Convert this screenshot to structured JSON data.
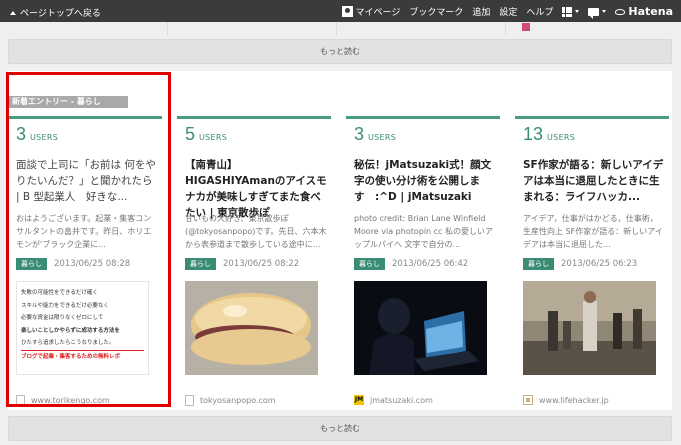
{
  "topbar": {
    "back_label": "ページトップへ戻る",
    "nav": [
      "マイページ",
      "ブックマーク",
      "追加",
      "設定",
      "ヘルプ"
    ],
    "brand": "Hatena"
  },
  "more_label": "もっと読む",
  "section_label": "新着エントリー - 暮らし",
  "users_label": "USERS",
  "cards": [
    {
      "users": "3",
      "title": "面談で上司に「お前は 何をやりたいんだ？」と聞かれたら | B 型起業人　好きな...",
      "summary": "おはようございます。起業・集客コンサルタントの畠井です。昨日、ホリエモンが'ブラック企業に...",
      "tag": "暮らし",
      "date": "2013/06/25 08:28",
      "thumb_lines": [
        "失敗の可能性をできるだけ確く",
        "スキルや能力をできるだけ必要なく",
        "必要な資金は限りなくゼロにして",
        "楽しいことしかやらずに成功する方法を",
        "ひたすら追求したらこうなりました。",
        "ブログで起業・集客するための無料レポ"
      ],
      "source": "www.torikengo.com"
    },
    {
      "users": "5",
      "title": "【南青山】HIGASHIYAmanのアイスモナカが美味しすぎてまた食べたい | 東京散歩ぽ",
      "summary": "甘いもの大好き、東京散歩ぽ(@tokyosanpopo)です。先日、六本木から表参道まで散歩している途中に...",
      "tag": "暮らし",
      "date": "2013/06/25 08:22",
      "source": "tokyosanpopo.com"
    },
    {
      "users": "3",
      "title": "秘伝！jMatsuzaki式！顔文字の使い分け術を公開します　:^D | jMatsuzaki",
      "summary": "photo credit: Brian Lane Winfield Moore via photopin cc 私の愛しいアップルパイへ 文字で自分の...",
      "tag": "暮らし",
      "date": "2013/06/25 06:42",
      "source": "jmatsuzaki.com"
    },
    {
      "users": "13",
      "title": "SF作家が語る：新しいアイデアは本当に退屈したときに生まれる：ライフハッカ...",
      "summary": "アイデア，仕事がはかどる，仕事術，生産性向上 SF作家が語る：新しいアイデアは本当に退屈した...",
      "tag": "暮らし",
      "date": "2013/06/25 06:23",
      "source": "www.lifehacker.jp"
    }
  ],
  "colors": {
    "accent": "#3a8c74",
    "highlight": "#e00000",
    "topbar": "#3b3b3b"
  }
}
